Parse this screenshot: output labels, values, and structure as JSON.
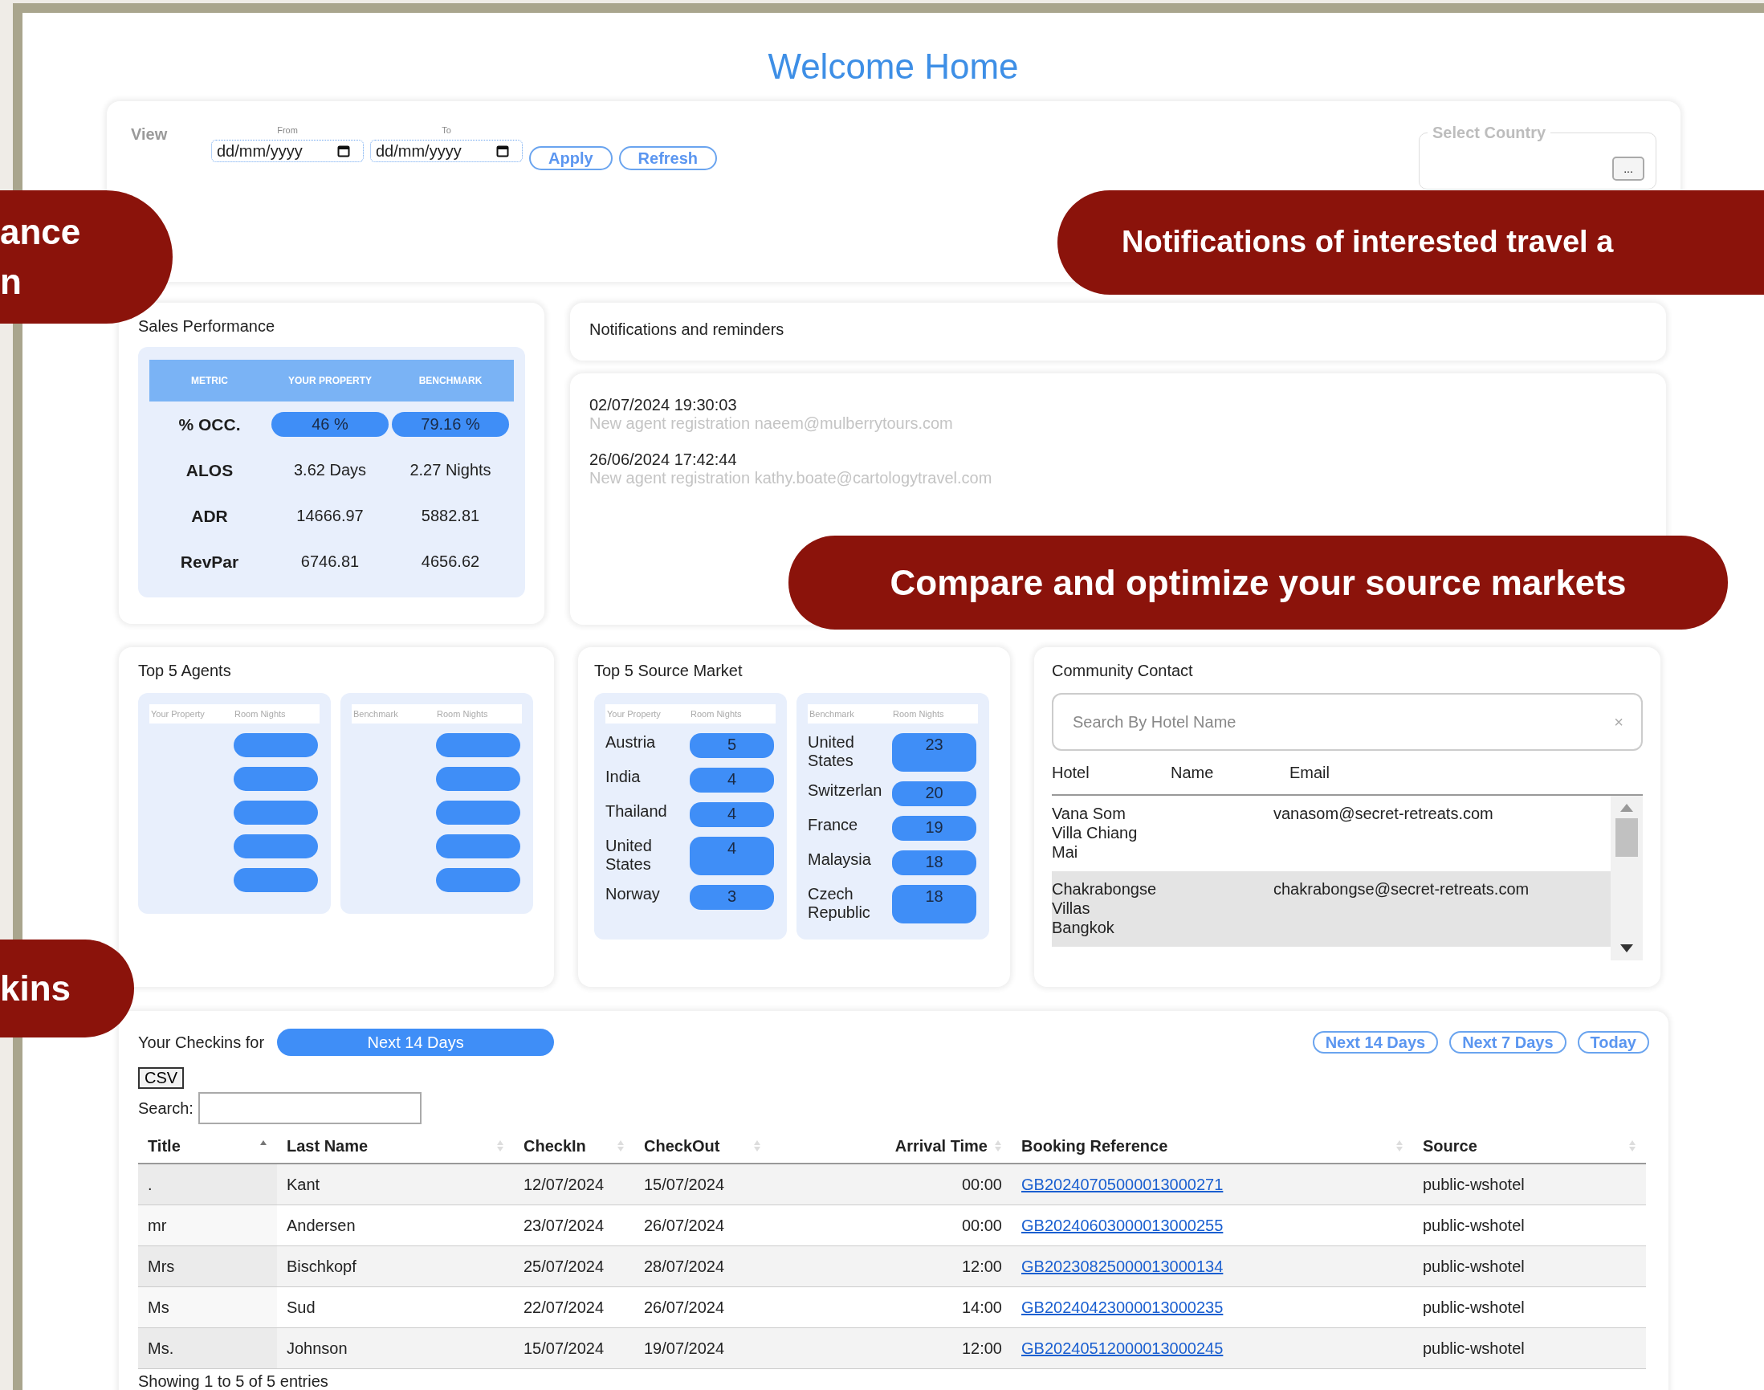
{
  "title": "Welcome Home",
  "filter": {
    "view_label": "View",
    "from_label": "From",
    "from_placeholder": "dd/mm/yyyy",
    "to_label": "To",
    "to_placeholder": "dd/mm/yyyy",
    "buttons": [
      "Apply",
      "Refresh"
    ],
    "country_legend": "Select Country",
    "country_button": "..."
  },
  "sales": {
    "title": "Sales Performance",
    "columns": [
      "METRIC",
      "YOUR PROPERTY",
      "BENCHMARK"
    ],
    "rows": [
      {
        "kind": "pill",
        "metric": "% OCC.",
        "property": "46 %",
        "benchmark": "79.16 %"
      },
      {
        "kind": "plain",
        "metric": "ALOS",
        "property": "3.62 Days",
        "benchmark": "2.27 Nights"
      },
      {
        "kind": "plain",
        "metric": "ADR",
        "property": "14666.97",
        "benchmark": "5882.81"
      },
      {
        "kind": "plain",
        "metric": "RevPar",
        "property": "6746.81",
        "benchmark": "4656.62"
      }
    ]
  },
  "notifications": {
    "title": "Notifications and reminders",
    "items": [
      {
        "time": "02/07/2024 19:30:03",
        "text": "New agent registration naeem@mulberrytours.com"
      },
      {
        "time": "26/06/2024 17:42:44",
        "text": "New agent registration kathy.boate@cartologytravel.com"
      }
    ]
  },
  "agents": {
    "title": "Top 5 Agents",
    "tables": [
      {
        "columns": [
          "Your Property",
          "Room Nights"
        ],
        "rows": [
          {
            "kind": "empty"
          },
          {
            "kind": "empty"
          },
          {
            "kind": "empty"
          },
          {
            "kind": "empty"
          },
          {
            "kind": "empty"
          }
        ]
      },
      {
        "columns": [
          "Benchmark",
          "Room Nights"
        ],
        "rows": [
          {
            "kind": "empty"
          },
          {
            "kind": "empty"
          },
          {
            "kind": "empty"
          },
          {
            "kind": "empty"
          },
          {
            "kind": "empty"
          }
        ]
      }
    ]
  },
  "source_market": {
    "title": "Top 5 Source Market",
    "tables": [
      {
        "columns": [
          "Your Property",
          "Room Nights"
        ],
        "rows": [
          {
            "country": "Austria",
            "nights": "5"
          },
          {
            "country": "India",
            "nights": "4"
          },
          {
            "country": "Thailand",
            "nights": "4"
          },
          {
            "country": "United States",
            "nights": "4"
          },
          {
            "country": "Norway",
            "nights": "3"
          }
        ]
      },
      {
        "columns": [
          "Benchmark",
          "Room Nights"
        ],
        "rows": [
          {
            "country": "United States",
            "nights": "23"
          },
          {
            "country": "Switzerlan",
            "nights": "20"
          },
          {
            "country": "France",
            "nights": "19"
          },
          {
            "country": "Malaysia",
            "nights": "18"
          },
          {
            "country": "Czech Republic",
            "nights": "18"
          }
        ]
      }
    ]
  },
  "contact": {
    "title": "Community Contact",
    "search_placeholder": "Search By Hotel Name",
    "clear": "×",
    "columns": [
      "Hotel",
      "Name",
      "Email"
    ],
    "rows": [
      {
        "hotel": "Vana Som Villa Chiang Mai",
        "email": "vanasom@secret-retreats.com",
        "highlighted": false
      },
      {
        "hotel": "Chakrabongse Villas Bangkok",
        "email": "chakrabongse@secret-retreats.com",
        "highlighted": true
      }
    ]
  },
  "checkins": {
    "label": "Your Checkins for",
    "period": "Next 14 Days",
    "range_buttons": [
      "Next 14 Days",
      "Next 7 Days",
      "Today"
    ],
    "csv": "CSV",
    "search_label": "Search:",
    "columns": [
      {
        "label": "Title",
        "sorted": true
      },
      {
        "label": "Last Name",
        "sorted": false
      },
      {
        "label": "CheckIn",
        "sorted": false
      },
      {
        "label": "CheckOut",
        "sorted": false
      },
      {
        "label": "Arrival Time",
        "sorted": false
      },
      {
        "label": "Booking Reference",
        "sorted": false
      },
      {
        "label": "Source",
        "sorted": false
      }
    ],
    "rows": [
      {
        "title": ".",
        "last_name": "Kant",
        "checkin": "12/07/2024",
        "checkout": "15/07/2024",
        "arrival": "00:00",
        "reference": "GB20240705000013000271",
        "source": "public-wshotel"
      },
      {
        "title": "mr",
        "last_name": "Andersen",
        "checkin": "23/07/2024",
        "checkout": "26/07/2024",
        "arrival": "00:00",
        "reference": "GB20240603000013000255",
        "source": "public-wshotel"
      },
      {
        "title": "Mrs",
        "last_name": "Bischkopf",
        "checkin": "25/07/2024",
        "checkout": "28/07/2024",
        "arrival": "12:00",
        "reference": "GB20230825000013000134",
        "source": "public-wshotel"
      },
      {
        "title": "Ms",
        "last_name": "Sud",
        "checkin": "22/07/2024",
        "checkout": "26/07/2024",
        "arrival": "14:00",
        "reference": "GB20240423000013000235",
        "source": "public-wshotel"
      },
      {
        "title": "Ms.",
        "last_name": "Johnson",
        "checkin": "15/07/2024",
        "checkout": "19/07/2024",
        "arrival": "12:00",
        "reference": "GB20240512000013000245",
        "source": "public-wshotel"
      }
    ],
    "footer": "Showing 1 to 5 of 5 entries"
  },
  "callouts": [
    {
      "lines": [
        "ance",
        "n"
      ]
    },
    {
      "lines": [
        "Notifications of interested travel a"
      ]
    },
    {
      "lines": [
        "Compare and optimize your source markets"
      ]
    },
    {
      "lines": [
        "kins"
      ]
    }
  ]
}
